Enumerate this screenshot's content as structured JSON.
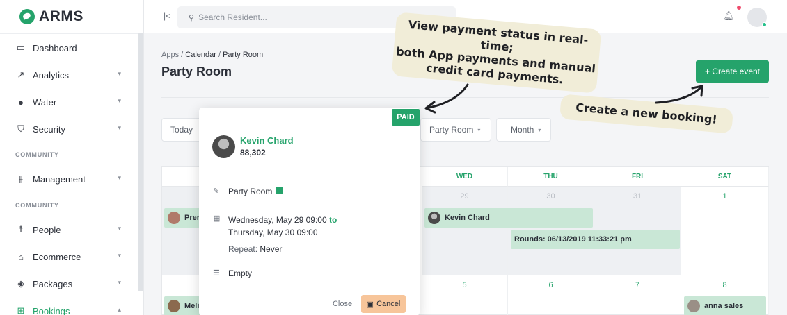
{
  "app": {
    "logo_text": "ARMS"
  },
  "sidebar": {
    "items": [
      {
        "label": "Dashboard",
        "icon": "dashboard-icon",
        "has_chevron": false
      },
      {
        "label": "Analytics",
        "icon": "analytics-icon",
        "has_chevron": true
      },
      {
        "label": "Water",
        "icon": "water-drop-icon",
        "has_chevron": true
      },
      {
        "label": "Security",
        "icon": "shield-icon",
        "has_chevron": true
      },
      {
        "label": "Management",
        "icon": "management-icon",
        "has_chevron": true
      },
      {
        "label": "People",
        "icon": "person-icon",
        "has_chevron": true
      },
      {
        "label": "Ecommerce",
        "icon": "bag-icon",
        "has_chevron": true
      },
      {
        "label": "Packages",
        "icon": "package-icon",
        "has_chevron": true
      },
      {
        "label": "Bookings",
        "icon": "grid-icon",
        "has_chevron": true,
        "active": true
      }
    ],
    "sections": [
      "COMMUNITY",
      "COMMUNITY"
    ]
  },
  "topbar": {
    "search_placeholder": "Search Resident..."
  },
  "breadcrumb": {
    "apps": "Apps",
    "sep": "/",
    "calendar": "Calendar",
    "current": "Party Room"
  },
  "page": {
    "title": "Party Room",
    "create_label": "+ Create event"
  },
  "toolbar": {
    "today": "Today",
    "room_filter": "Party Room",
    "view": "Month"
  },
  "calendar": {
    "headers": [
      "S",
      "WED",
      "THU",
      "FRI",
      "SAT"
    ],
    "row1": {
      "wed": "29",
      "thu": "30",
      "fri": "31",
      "sat": "1"
    },
    "row2": {
      "wed": "5",
      "thu": "6",
      "fri": "7",
      "sat": "8"
    },
    "events": {
      "sun_partial": "Prer",
      "kevin": "Kevin Chard",
      "rounds": "Rounds: 06/13/2019 11:33:21 pm",
      "sun_partial2": "Meli",
      "anna": "anna sales"
    }
  },
  "popover": {
    "status": "PAID",
    "name": "Kevin Chard",
    "amount": "88,302",
    "room": "Party Room",
    "start": "Wednesday, May 29 09:00",
    "to": "to",
    "end": "Thursday, May 30 09:00",
    "repeat_label": "Repeat:",
    "repeat_value": "Never",
    "notes": "Empty",
    "close_label": "Close",
    "cancel_label": "Cancel"
  },
  "callouts": {
    "payment_line1": "View payment status in real-time;",
    "payment_line2": "both App payments and manual",
    "payment_line3": "credit card payments.",
    "booking": "Create a new booking!"
  },
  "colors": {
    "brand": "#25a36b",
    "event": "#c9e7d6",
    "cancel": "#f7c59a",
    "callout": "#f1edd8"
  }
}
